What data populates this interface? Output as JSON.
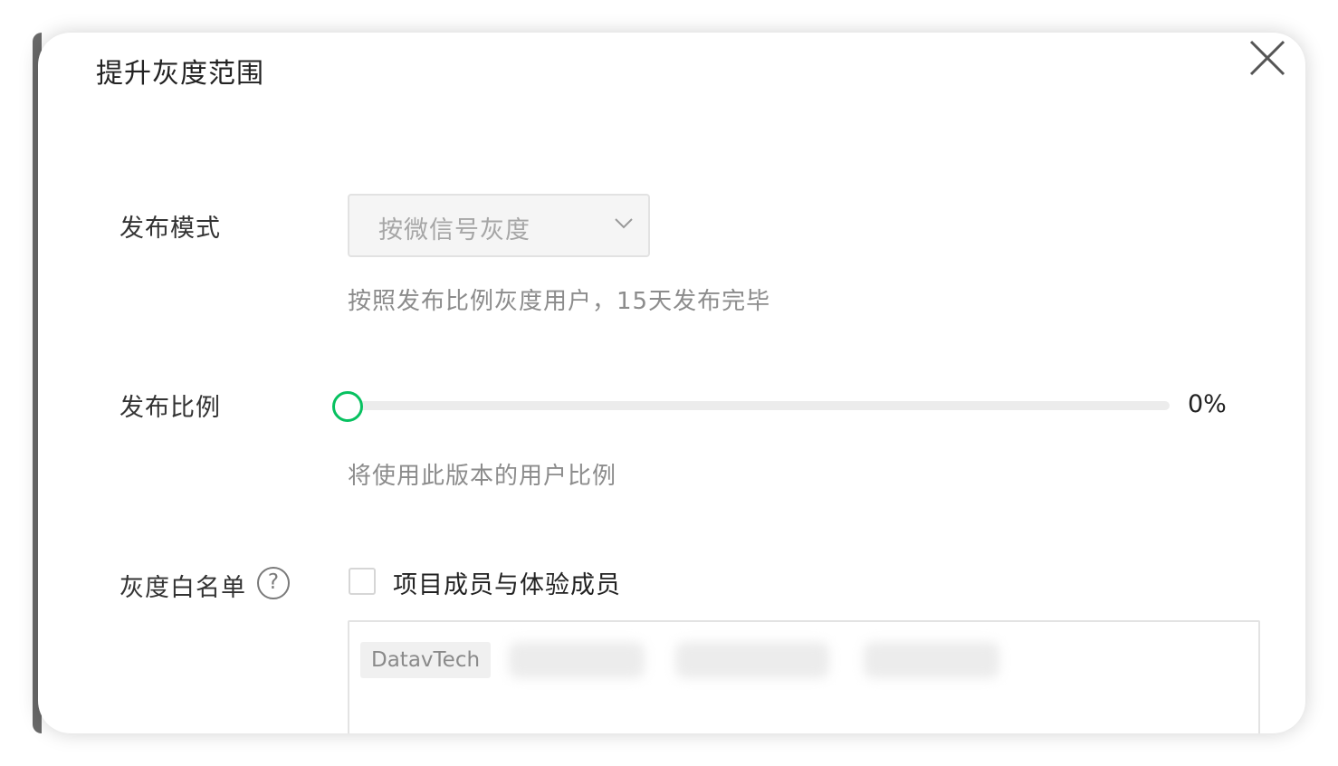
{
  "dialog": {
    "title": "提升灰度范围"
  },
  "publish_mode": {
    "label": "发布模式",
    "selected": "按微信号灰度",
    "hint": "按照发布比例灰度用户，15天发布完毕"
  },
  "publish_ratio": {
    "label": "发布比例",
    "value_text": "0%",
    "value_percent": 0,
    "hint": "将使用此版本的用户比例"
  },
  "whitelist": {
    "label": "灰度白名单",
    "help_symbol": "?",
    "checkbox_label": "项目成员与体验成员",
    "checked": false,
    "tags": [
      "DatavTech"
    ]
  },
  "colors": {
    "accent": "#07c160"
  },
  "icons": {
    "close": "close-icon",
    "dropdown": "chevron-down-icon",
    "help": "question-circle-icon"
  }
}
